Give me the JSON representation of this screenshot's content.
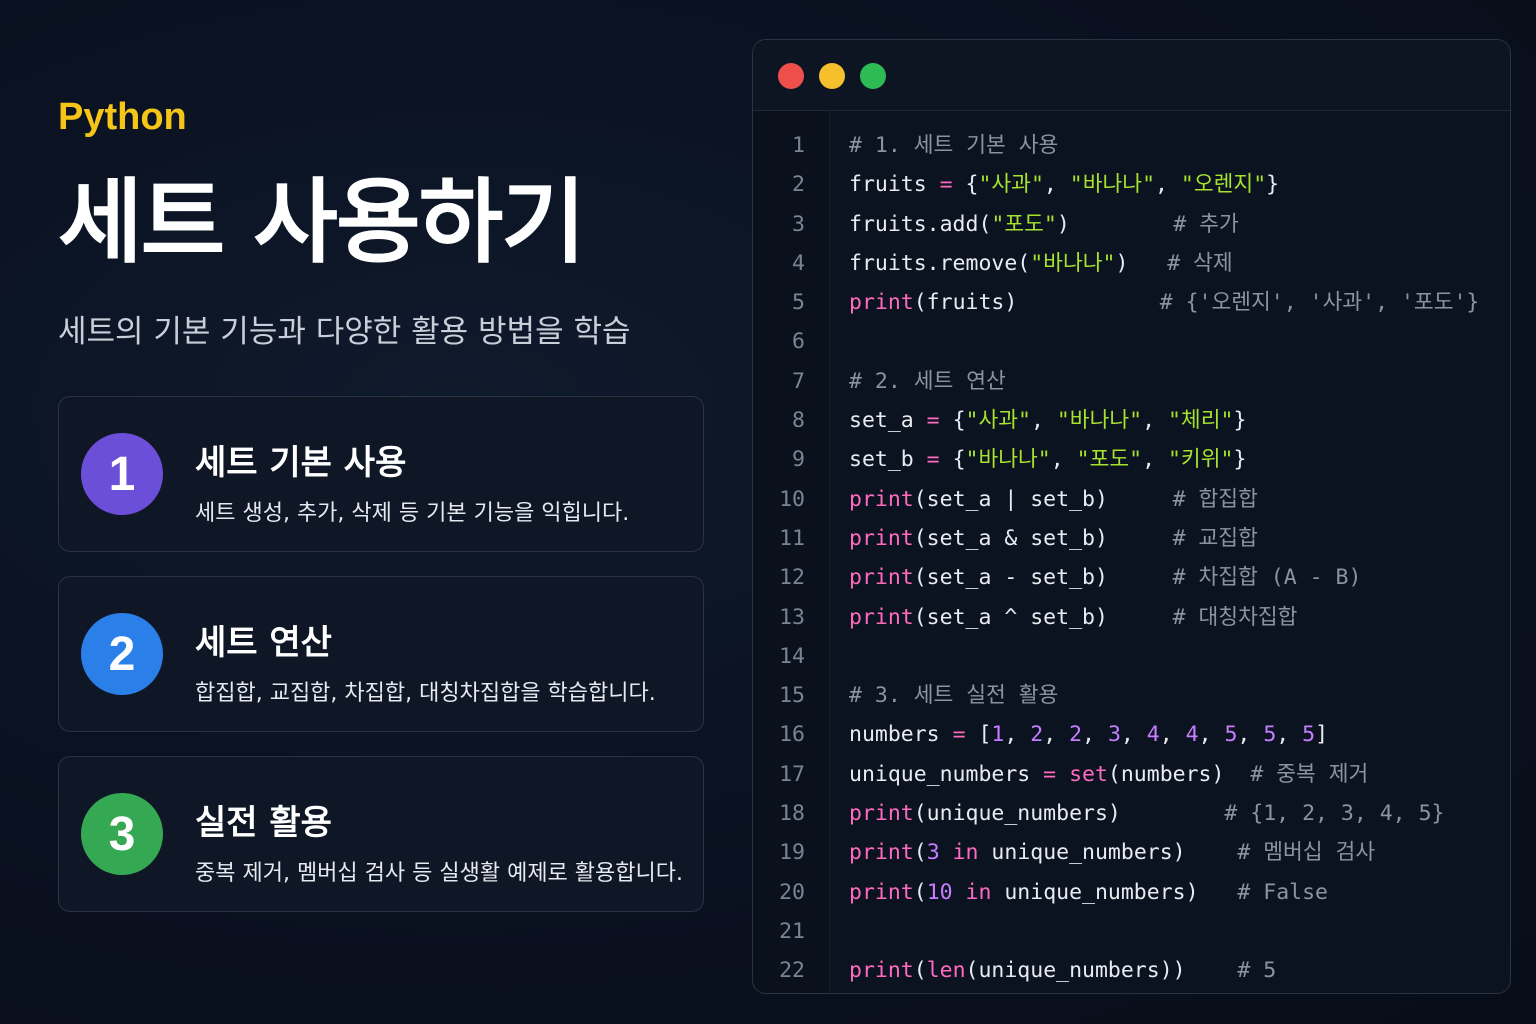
{
  "left": {
    "lang": "Python",
    "title": "세트 사용하기",
    "subtitle": "세트의 기본 기능과 다양한 활용 방법을 학습",
    "cards": [
      {
        "number": "1",
        "title": "세트 기본 사용",
        "desc": "세트 생성, 추가, 삭제 등 기본 기능을 익힙니다.",
        "color": "#6c4fd8"
      },
      {
        "number": "2",
        "title": "세트 연산",
        "desc": "합집합, 교집합, 차집합, 대칭차집합을 학습합니다.",
        "color": "#2a7fe8"
      },
      {
        "number": "3",
        "title": "실전 활용",
        "desc": "중복 제거, 멤버십 검사 등 실생활 예제로 활용합니다.",
        "color": "#34a853"
      }
    ]
  },
  "editor": {
    "window_controls": [
      "close",
      "minimize",
      "maximize"
    ],
    "colors": {
      "keyword": "#ff6ac1",
      "string": "#a6e22e",
      "number": "#c77dff",
      "comment": "#8b93a3",
      "text": "#e8ecf2"
    },
    "lines": [
      {
        "n": "1",
        "tokens": [
          [
            "# 1. 세트 기본 사용",
            "cmt"
          ]
        ]
      },
      {
        "n": "2",
        "tokens": [
          [
            "fruits ",
            ""
          ],
          [
            "=",
            "op"
          ],
          [
            " {",
            ""
          ],
          [
            "\"사과\"",
            "str"
          ],
          [
            ", ",
            ""
          ],
          [
            "\"바나나\"",
            "str"
          ],
          [
            ", ",
            ""
          ],
          [
            "\"오렌지\"",
            "str"
          ],
          [
            "}",
            ""
          ]
        ]
      },
      {
        "n": "3",
        "tokens": [
          [
            "fruits.add(",
            ""
          ],
          [
            "\"포도\"",
            "str"
          ],
          [
            ")        ",
            ""
          ],
          [
            "# 추가",
            "cmt"
          ]
        ]
      },
      {
        "n": "4",
        "tokens": [
          [
            "fruits.remove(",
            ""
          ],
          [
            "\"바나나\"",
            "str"
          ],
          [
            ")   ",
            ""
          ],
          [
            "# 삭제",
            "cmt"
          ]
        ]
      },
      {
        "n": "5",
        "tokens": [
          [
            "print",
            "kw"
          ],
          [
            "(fruits)           ",
            ""
          ],
          [
            "# {'오렌지', '사과', '포도'}",
            "cmt"
          ]
        ]
      },
      {
        "n": "6",
        "tokens": []
      },
      {
        "n": "7",
        "tokens": [
          [
            "# 2. 세트 연산",
            "cmt"
          ]
        ]
      },
      {
        "n": "8",
        "tokens": [
          [
            "set_a ",
            ""
          ],
          [
            "=",
            "op"
          ],
          [
            " {",
            ""
          ],
          [
            "\"사과\"",
            "str"
          ],
          [
            ", ",
            ""
          ],
          [
            "\"바나나\"",
            "str"
          ],
          [
            ", ",
            ""
          ],
          [
            "\"체리\"",
            "str"
          ],
          [
            "}",
            ""
          ]
        ]
      },
      {
        "n": "9",
        "tokens": [
          [
            "set_b ",
            ""
          ],
          [
            "=",
            "op"
          ],
          [
            " {",
            ""
          ],
          [
            "\"바나나\"",
            "str"
          ],
          [
            ", ",
            ""
          ],
          [
            "\"포도\"",
            "str"
          ],
          [
            ", ",
            ""
          ],
          [
            "\"키위\"",
            "str"
          ],
          [
            "}",
            ""
          ]
        ]
      },
      {
        "n": "10",
        "tokens": [
          [
            "print",
            "kw"
          ],
          [
            "(set_a | set_b)     ",
            ""
          ],
          [
            "# 합집합",
            "cmt"
          ]
        ]
      },
      {
        "n": "11",
        "tokens": [
          [
            "print",
            "kw"
          ],
          [
            "(set_a & set_b)     ",
            ""
          ],
          [
            "# 교집합",
            "cmt"
          ]
        ]
      },
      {
        "n": "12",
        "tokens": [
          [
            "print",
            "kw"
          ],
          [
            "(set_a - set_b)     ",
            ""
          ],
          [
            "# 차집합 (A - B)",
            "cmt"
          ]
        ]
      },
      {
        "n": "13",
        "tokens": [
          [
            "print",
            "kw"
          ],
          [
            "(set_a ^ set_b)     ",
            ""
          ],
          [
            "# 대칭차집합",
            "cmt"
          ]
        ]
      },
      {
        "n": "14",
        "tokens": []
      },
      {
        "n": "15",
        "tokens": [
          [
            "# 3. 세트 실전 활용",
            "cmt"
          ]
        ]
      },
      {
        "n": "16",
        "tokens": [
          [
            "numbers ",
            ""
          ],
          [
            "=",
            "op"
          ],
          [
            " [",
            ""
          ],
          [
            "1",
            "num"
          ],
          [
            ", ",
            ""
          ],
          [
            "2",
            "num"
          ],
          [
            ", ",
            ""
          ],
          [
            "2",
            "num"
          ],
          [
            ", ",
            ""
          ],
          [
            "3",
            "num"
          ],
          [
            ", ",
            ""
          ],
          [
            "4",
            "num"
          ],
          [
            ", ",
            ""
          ],
          [
            "4",
            "num"
          ],
          [
            ", ",
            ""
          ],
          [
            "5",
            "num"
          ],
          [
            ", ",
            ""
          ],
          [
            "5",
            "num"
          ],
          [
            ", ",
            ""
          ],
          [
            "5",
            "num"
          ],
          [
            "]",
            ""
          ]
        ]
      },
      {
        "n": "17",
        "tokens": [
          [
            "unique_numbers ",
            ""
          ],
          [
            "=",
            "op"
          ],
          [
            " ",
            ""
          ],
          [
            "set",
            "kw"
          ],
          [
            "(numbers)  ",
            ""
          ],
          [
            "# 중복 제거",
            "cmt"
          ]
        ]
      },
      {
        "n": "18",
        "tokens": [
          [
            "print",
            "kw"
          ],
          [
            "(unique_numbers)        ",
            ""
          ],
          [
            "# {1, 2, 3, 4, 5}",
            "cmt"
          ]
        ]
      },
      {
        "n": "19",
        "tokens": [
          [
            "print",
            "kw"
          ],
          [
            "(",
            ""
          ],
          [
            "3",
            "num"
          ],
          [
            " ",
            ""
          ],
          [
            "in",
            "kw"
          ],
          [
            " unique_numbers)    ",
            ""
          ],
          [
            "# 멤버십 검사",
            "cmt"
          ]
        ]
      },
      {
        "n": "20",
        "tokens": [
          [
            "print",
            "kw"
          ],
          [
            "(",
            ""
          ],
          [
            "10",
            "num"
          ],
          [
            " ",
            ""
          ],
          [
            "in",
            "kw"
          ],
          [
            " unique_numbers)   ",
            ""
          ],
          [
            "# False",
            "cmt"
          ]
        ]
      },
      {
        "n": "21",
        "tokens": []
      },
      {
        "n": "22",
        "tokens": [
          [
            "print",
            "kw"
          ],
          [
            "(",
            ""
          ],
          [
            "len",
            "kw"
          ],
          [
            "(unique_numbers))    ",
            ""
          ],
          [
            "# 5",
            "cmt"
          ]
        ]
      }
    ]
  }
}
